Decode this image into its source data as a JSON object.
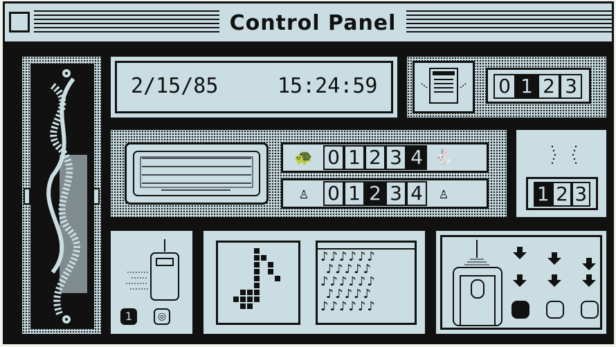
{
  "window": {
    "title": "Control Panel"
  },
  "datetime": {
    "date": "2/15/85",
    "time": "15:24:59"
  },
  "speaker_volume": {
    "digits": [
      "0",
      "1",
      "2",
      "3"
    ],
    "selected": "1"
  },
  "key_repeat_rate": {
    "digits": [
      "0",
      "1",
      "2",
      "3",
      "4"
    ],
    "selected": "4",
    "slow_icon": "turtle-icon",
    "fast_icon": "rabbit-icon"
  },
  "key_delay": {
    "digits": [
      "0",
      "1",
      "2",
      "3",
      "4"
    ],
    "selected": "2"
  },
  "caret_blink": {
    "digits": [
      "1",
      "2",
      "3"
    ],
    "selected": "1"
  },
  "mouse_tracking": {
    "options": [
      "1",
      "◎"
    ],
    "selected": "1"
  },
  "double_click": {
    "selected_index": 0
  },
  "colors": {
    "background": "#c9dde2",
    "ink": "#111111"
  }
}
